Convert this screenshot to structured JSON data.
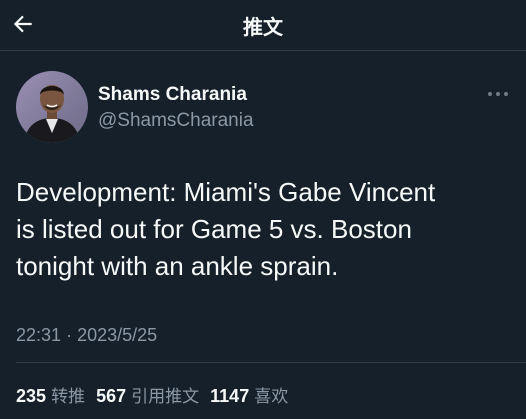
{
  "header": {
    "title": "推文",
    "back_icon": "arrow-left-icon"
  },
  "author": {
    "avatar_icon": "user-avatar",
    "name": "Shams Charania",
    "handle": "@ShamsCharania",
    "more_icon": "more-horizontal-icon"
  },
  "tweet": {
    "text": "Development: Miami's Gabe Vincent\nis listed out for Game 5 vs. Boston\ntonight with an ankle sprain."
  },
  "meta": {
    "time": "22:31",
    "separator": "·",
    "date": "2023/5/25"
  },
  "stats": {
    "retweets": {
      "count": "235",
      "label": "转推"
    },
    "quotes": {
      "count": "567",
      "label": "引用推文"
    },
    "likes": {
      "count": "1147",
      "label": "喜欢"
    }
  },
  "colors": {
    "background": "#15202b",
    "primary_text": "#f7f9f9",
    "secondary_text": "#8b98a5",
    "divider": "#2f3b47"
  }
}
